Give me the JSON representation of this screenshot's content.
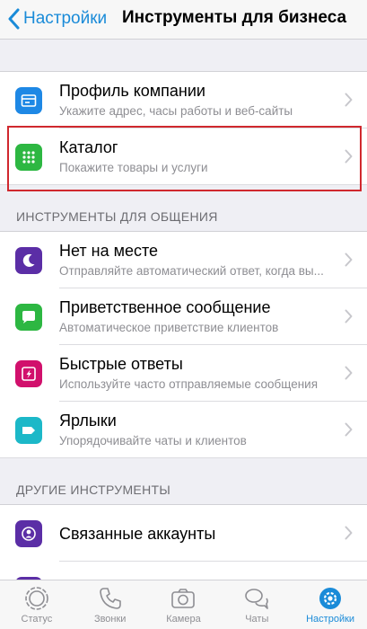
{
  "navbar": {
    "back_label": "Настройки",
    "title": "Инструменты для бизнеса"
  },
  "group_business": [
    {
      "title": "Профиль компании",
      "subtitle": "Укажите адрес, часы работы и веб-сайты",
      "icon": "storefront-icon",
      "color": "#1e88e5"
    },
    {
      "title": "Каталог",
      "subtitle": "Покажите товары и услуги",
      "icon": "grid-icon",
      "color": "#2db742"
    }
  ],
  "section_communication": {
    "header": "ИНСТРУМЕНТЫ ДЛЯ ОБЩЕНИЯ",
    "items": [
      {
        "title": "Нет на месте",
        "subtitle": "Отправляйте автоматический ответ, когда вы...",
        "icon": "moon-icon",
        "color": "#5b2ea6"
      },
      {
        "title": "Приветственное сообщение",
        "subtitle": "Автоматическое приветствие клиентов",
        "icon": "chat-bubble-icon",
        "color": "#2db742"
      },
      {
        "title": "Быстрые ответы",
        "subtitle": "Используйте часто отправляемые сообщения",
        "icon": "lightning-icon",
        "color": "#d1106c"
      },
      {
        "title": "Ярлыки",
        "subtitle": "Упорядочивайте чаты и клиентов",
        "icon": "label-icon",
        "color": "#1cb8c8"
      }
    ]
  },
  "section_other": {
    "header": "ДРУГИЕ ИНСТРУМЕНТЫ",
    "items": [
      {
        "title": "Связанные аккаунты",
        "icon": "linked-accounts-icon",
        "color": "#5b2ea6"
      }
    ]
  },
  "tabs": [
    {
      "label": "Статус",
      "icon": "status-icon",
      "active": false
    },
    {
      "label": "Звонки",
      "icon": "phone-icon",
      "active": false
    },
    {
      "label": "Камера",
      "icon": "camera-icon",
      "active": false
    },
    {
      "label": "Чаты",
      "icon": "chats-icon",
      "active": false
    },
    {
      "label": "Настройки",
      "icon": "settings-gear-icon",
      "active": true
    }
  ],
  "colors": {
    "accent": "#1a8bd8",
    "highlight_border": "#d0282e"
  }
}
